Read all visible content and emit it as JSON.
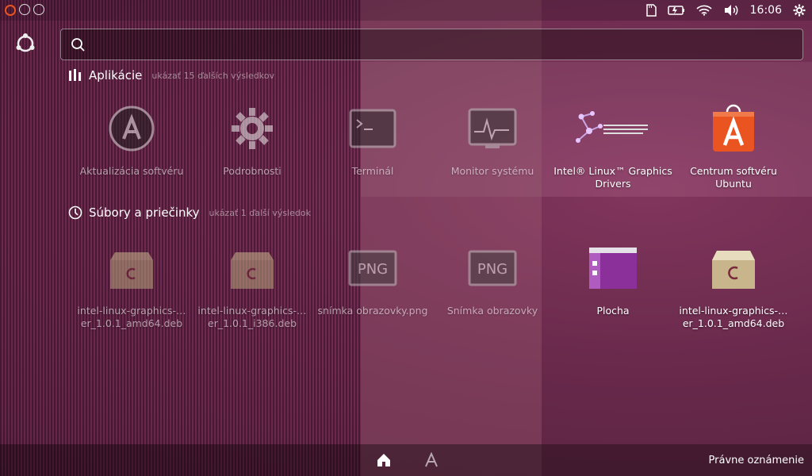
{
  "top_panel": {
    "clock": "16:06",
    "icons": [
      "ubuntu-logo-icon",
      "window-icon",
      "network-icon",
      "sd-card-icon",
      "battery-icon",
      "wifi-icon",
      "volume-icon",
      "gear-icon"
    ]
  },
  "search": {
    "value": "",
    "placeholder": ""
  },
  "categories": {
    "apps": {
      "title": "Aplikácie",
      "more": "ukázať 15 ďalších výsledkov"
    },
    "files": {
      "title": "Súbory a priečinky",
      "more": "ukázať 1 ďalší výsledok"
    }
  },
  "apps": [
    {
      "label": "Aktualizácia softvéru",
      "icon": "software-updater-icon"
    },
    {
      "label": "Podrobnosti",
      "icon": "system-settings-icon"
    },
    {
      "label": "Terminál",
      "icon": "terminal-icon"
    },
    {
      "label": "Monitor systému",
      "icon": "system-monitor-icon"
    },
    {
      "label": "Intel® Linux™ Graphics Drivers",
      "icon": "intel-otc-icon"
    },
    {
      "label": "Centrum softvéru Ubuntu",
      "icon": "software-center-icon"
    }
  ],
  "files": [
    {
      "label": "intel-linux-graphics-…er_1.0.1_amd64.deb",
      "icon": "deb-package-icon"
    },
    {
      "label": "intel-linux-graphics-…er_1.0.1_i386.deb",
      "icon": "deb-package-icon"
    },
    {
      "label": "snímka obrazovky.png",
      "icon": "png-image-icon"
    },
    {
      "label": "Snímka obrazovky",
      "icon": "png-image-icon"
    },
    {
      "label": "Plocha",
      "icon": "desktop-folder-icon"
    },
    {
      "label": "intel-linux-graphics-…er_1.0.1_amd64.deb",
      "icon": "deb-package-icon"
    }
  ],
  "bottom": {
    "legal": "Právne oznámenie"
  },
  "colors": {
    "accent": "#e95420",
    "background": "#6f2c50"
  }
}
